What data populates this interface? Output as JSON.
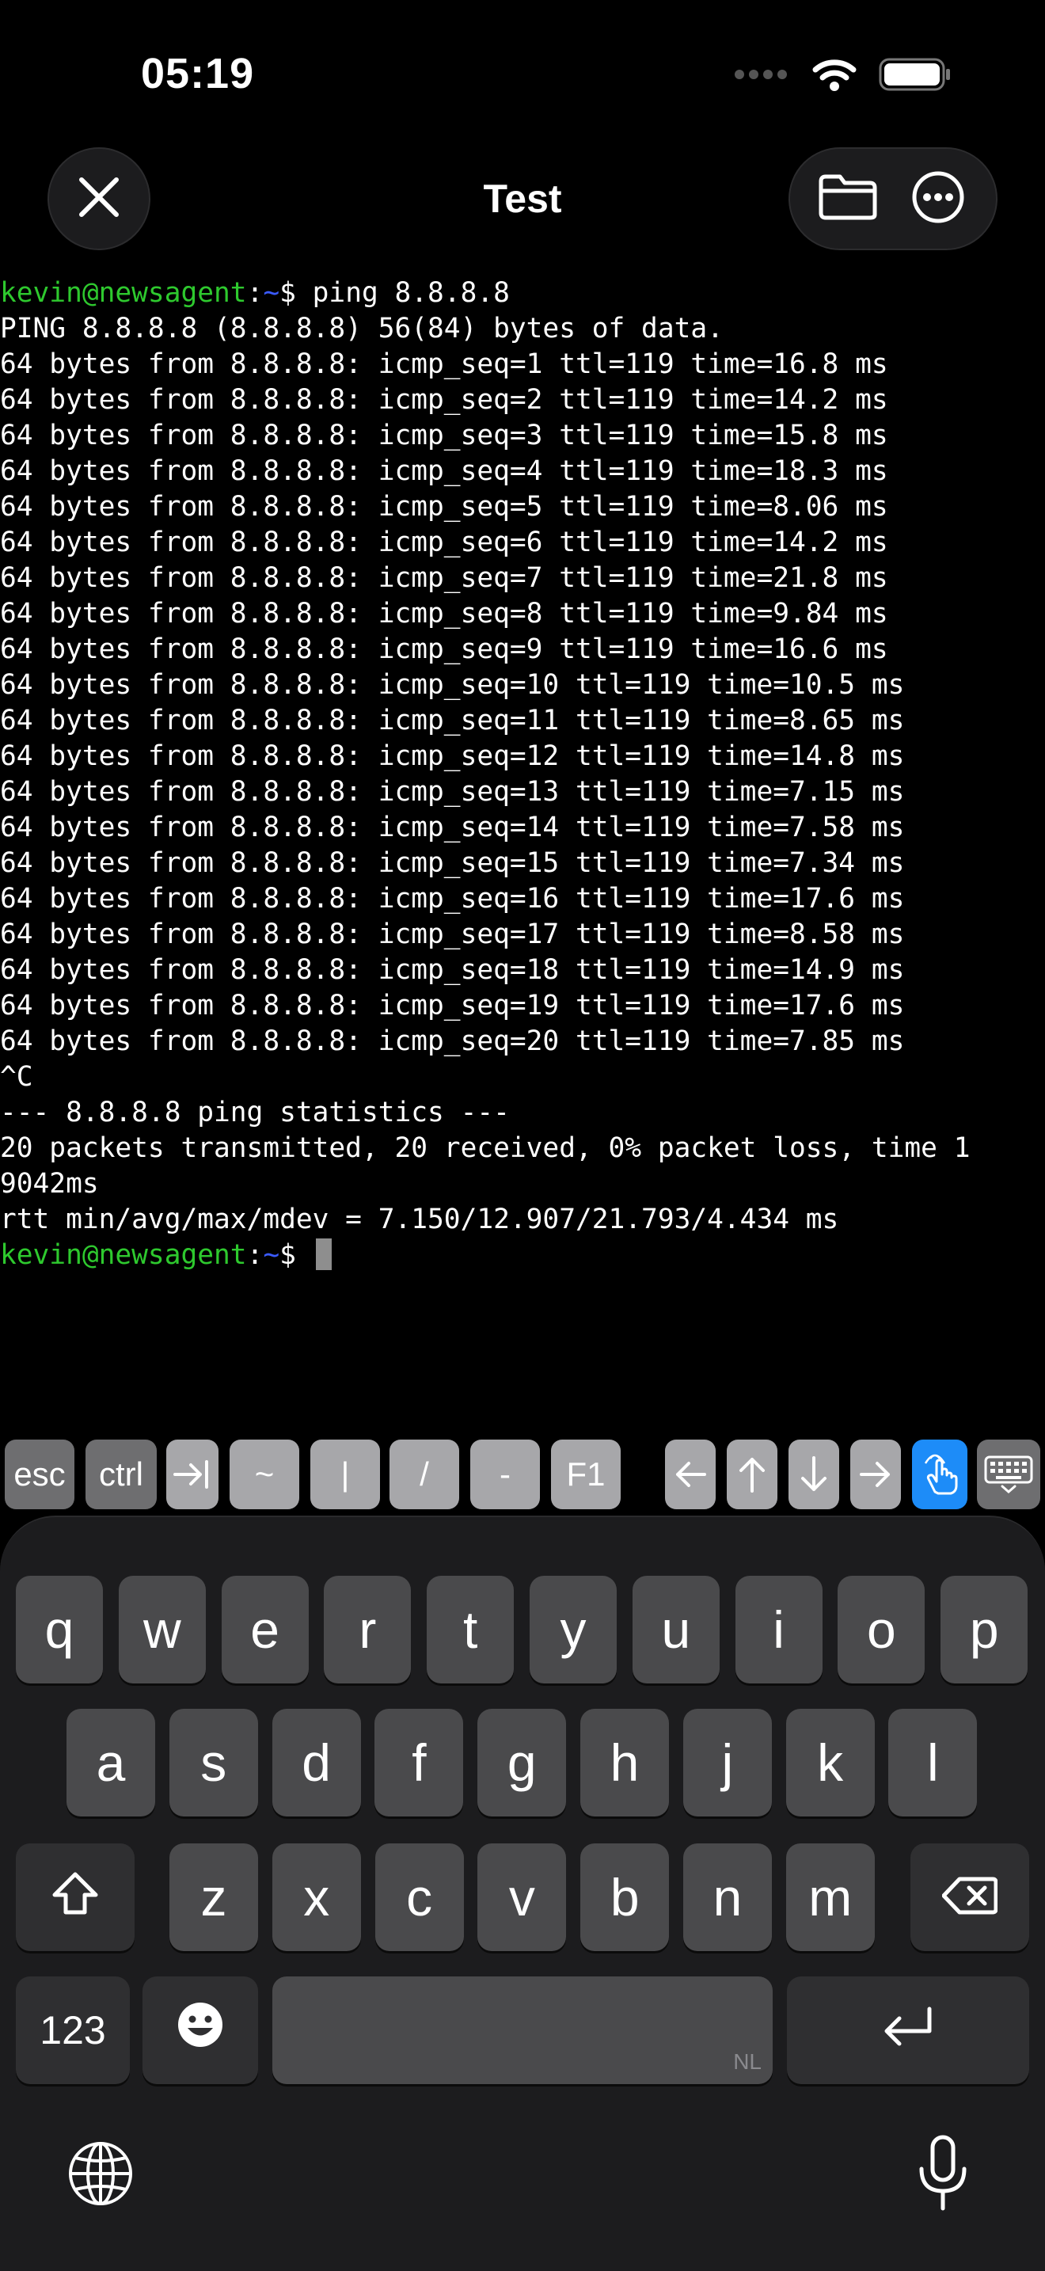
{
  "status": {
    "time": "05:19"
  },
  "nav": {
    "title": "Test"
  },
  "terminal": {
    "lines": [
      {
        "user": "kevin@newsagent",
        "colon": ":",
        "path": "~",
        "rest": "$ ping 8.8.8.8"
      },
      {
        "text": "PING 8.8.8.8 (8.8.8.8) 56(84) bytes of data."
      },
      {
        "text": "64 bytes from 8.8.8.8: icmp_seq=1 ttl=119 time=16.8 ms"
      },
      {
        "text": "64 bytes from 8.8.8.8: icmp_seq=2 ttl=119 time=14.2 ms"
      },
      {
        "text": "64 bytes from 8.8.8.8: icmp_seq=3 ttl=119 time=15.8 ms"
      },
      {
        "text": "64 bytes from 8.8.8.8: icmp_seq=4 ttl=119 time=18.3 ms"
      },
      {
        "text": "64 bytes from 8.8.8.8: icmp_seq=5 ttl=119 time=8.06 ms"
      },
      {
        "text": "64 bytes from 8.8.8.8: icmp_seq=6 ttl=119 time=14.2 ms"
      },
      {
        "text": "64 bytes from 8.8.8.8: icmp_seq=7 ttl=119 time=21.8 ms"
      },
      {
        "text": "64 bytes from 8.8.8.8: icmp_seq=8 ttl=119 time=9.84 ms"
      },
      {
        "text": "64 bytes from 8.8.8.8: icmp_seq=9 ttl=119 time=16.6 ms"
      },
      {
        "text": "64 bytes from 8.8.8.8: icmp_seq=10 ttl=119 time=10.5 ms"
      },
      {
        "text": "64 bytes from 8.8.8.8: icmp_seq=11 ttl=119 time=8.65 ms"
      },
      {
        "text": "64 bytes from 8.8.8.8: icmp_seq=12 ttl=119 time=14.8 ms"
      },
      {
        "text": "64 bytes from 8.8.8.8: icmp_seq=13 ttl=119 time=7.15 ms"
      },
      {
        "text": "64 bytes from 8.8.8.8: icmp_seq=14 ttl=119 time=7.58 ms"
      },
      {
        "text": "64 bytes from 8.8.8.8: icmp_seq=15 ttl=119 time=7.34 ms"
      },
      {
        "text": "64 bytes from 8.8.8.8: icmp_seq=16 ttl=119 time=17.6 ms"
      },
      {
        "text": "64 bytes from 8.8.8.8: icmp_seq=17 ttl=119 time=8.58 ms"
      },
      {
        "text": "64 bytes from 8.8.8.8: icmp_seq=18 ttl=119 time=14.9 ms"
      },
      {
        "text": "64 bytes from 8.8.8.8: icmp_seq=19 ttl=119 time=17.6 ms"
      },
      {
        "text": "64 bytes from 8.8.8.8: icmp_seq=20 ttl=119 time=7.85 ms"
      },
      {
        "text": "^C"
      },
      {
        "text": "--- 8.8.8.8 ping statistics ---"
      },
      {
        "text": "20 packets transmitted, 20 received, 0% packet loss, time 1"
      },
      {
        "text": "9042ms"
      },
      {
        "text": "rtt min/avg/max/mdev = 7.150/12.907/21.793/4.434 ms"
      },
      {
        "user": "kevin@newsagent",
        "colon": ":",
        "path": "~",
        "rest": "$ ",
        "cursor": true
      }
    ],
    "colors": {
      "user": "#2ec92e",
      "path": "#3b5bff",
      "text": "#ffffff",
      "background": "#000000"
    }
  },
  "accessory": {
    "keys": [
      {
        "name": "esc-key",
        "label": "esc",
        "icon": null
      },
      {
        "name": "ctrl-key",
        "label": "ctrl",
        "icon": null
      },
      {
        "name": "tab-key",
        "label": "",
        "icon": "tab-arrow-icon"
      },
      {
        "name": "tilde-key",
        "label": "~",
        "icon": null
      },
      {
        "name": "pipe-key",
        "label": "|",
        "icon": null
      },
      {
        "name": "slash-key",
        "label": "/",
        "icon": null
      },
      {
        "name": "dash-key",
        "label": "-",
        "icon": null
      },
      {
        "name": "f1-key",
        "label": "F1",
        "icon": null
      },
      {
        "name": "arrow-left-key",
        "label": "",
        "icon": "arrow-left-icon"
      },
      {
        "name": "arrow-up-key",
        "label": "",
        "icon": "arrow-up-icon"
      },
      {
        "name": "arrow-down-key",
        "label": "",
        "icon": "arrow-down-icon"
      },
      {
        "name": "arrow-right-key",
        "label": "",
        "icon": "arrow-right-icon"
      },
      {
        "name": "touch-mode-key",
        "label": "",
        "icon": "hand-tap-icon",
        "active": true
      },
      {
        "name": "hide-keyboard-key",
        "label": "",
        "icon": "keyboard-icon"
      }
    ],
    "active_color": "#1d8cf8"
  },
  "keyboard": {
    "row1": [
      "q",
      "w",
      "e",
      "r",
      "t",
      "y",
      "u",
      "i",
      "o",
      "p"
    ],
    "row2": [
      "a",
      "s",
      "d",
      "f",
      "g",
      "h",
      "j",
      "k",
      "l"
    ],
    "row3": [
      "z",
      "x",
      "c",
      "v",
      "b",
      "n",
      "m"
    ],
    "numbers_label": "123",
    "space_lang": "NL",
    "icons": {
      "shift": "shift-icon",
      "delete": "delete-icon",
      "emoji": "emoji-icon",
      "return": "return-icon",
      "globe": "globe-icon",
      "mic": "microphone-icon"
    }
  }
}
